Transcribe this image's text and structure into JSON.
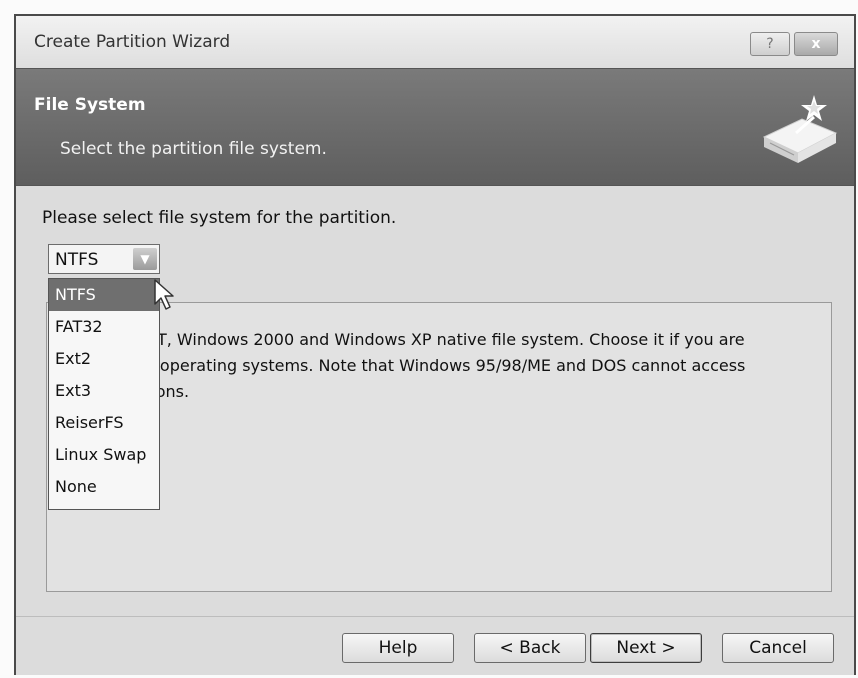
{
  "window": {
    "title": "Create Partition Wizard",
    "help_button": "?",
    "close_button": "x"
  },
  "header": {
    "title": "File System",
    "subtitle": "Select the partition file system.",
    "icon": "disk-wizard-icon"
  },
  "content": {
    "prompt": "Please select file system for the partition.",
    "filesystem_select": {
      "selected": "NTFS",
      "options": [
        "NTFS",
        "FAT32",
        "Ext2",
        "Ext3",
        "ReiserFS",
        "Linux Swap",
        "None"
      ],
      "highlighted_index": 0
    },
    "description_lines": [
      "NT, Windows 2000 and Windows XP native file system. Choose it if you are",
      "e operating systems. Note that Windows 95/98/ME and DOS cannot access",
      "tions."
    ]
  },
  "footer": {
    "help": "Help",
    "back": "< Back",
    "next": "Next >",
    "cancel": "Cancel"
  },
  "colors": {
    "header_band": "#6a6a6a",
    "selected_item": "#6f6f6f"
  }
}
